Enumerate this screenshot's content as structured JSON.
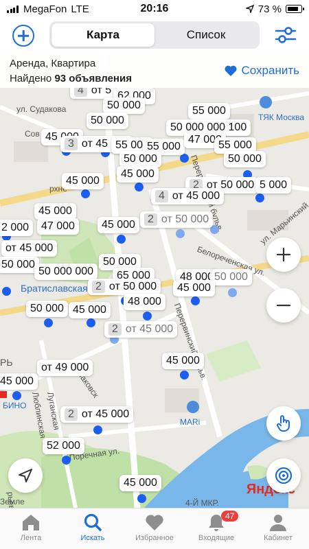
{
  "status_bar": {
    "carrier": "MegaFon",
    "network": "LTE",
    "time": "20:16",
    "battery": "73 %"
  },
  "header": {
    "add_icon": "plus-circle-icon",
    "tabs": [
      {
        "label": "Карта",
        "active": true
      },
      {
        "label": "Список",
        "active": false
      }
    ],
    "filter_icon": "sliders-icon"
  },
  "info_bar": {
    "query": "Аренда, Квартира",
    "found_prefix": "Найдено",
    "found_count": "93 объявления",
    "save_label": "Сохранить",
    "save_icon": "heart-icon"
  },
  "map": {
    "labels": [
      {
        "count": "",
        "price": "62 000"
      },
      {
        "count": "",
        "price": "50 000"
      },
      {
        "count": "",
        "price": "50 000"
      },
      {
        "count": "",
        "price": "55 000"
      },
      {
        "count": "",
        "price": "50 000 000 100"
      },
      {
        "count": "",
        "price": "45 000"
      },
      {
        "count": "3",
        "price": "от 45 000"
      },
      {
        "count": "",
        "price": "55 000"
      },
      {
        "count": "",
        "price": "55 000"
      },
      {
        "count": "",
        "price": "47 000"
      },
      {
        "count": "",
        "price": "55 000"
      },
      {
        "count": "",
        "price": "50 000"
      },
      {
        "count": "",
        "price": "50 000"
      },
      {
        "count": "",
        "price": "45 000"
      },
      {
        "count": "",
        "price": "45 000"
      },
      {
        "count": "2",
        "price": "от 50 000"
      },
      {
        "count": "",
        "price": "5 000"
      },
      {
        "count": "4",
        "price": "от 45 000"
      },
      {
        "count": "",
        "price": "45 000"
      },
      {
        "count": "",
        "price": "47 000"
      },
      {
        "count": "",
        "price": "2 000"
      },
      {
        "count": "",
        "price": "45 000"
      },
      {
        "count": "2",
        "price": "от 50 000"
      },
      {
        "count": "",
        "price": "от 45 000"
      },
      {
        "count": "",
        "price": "50 000"
      },
      {
        "count": "",
        "price": "50 000 000"
      },
      {
        "count": "",
        "price": "50 000"
      },
      {
        "count": "",
        "price": "65 000"
      },
      {
        "count": "",
        "price": "48 000"
      },
      {
        "count": "",
        "price": "50 000"
      },
      {
        "count": "2",
        "price": "от 50 000"
      },
      {
        "count": "",
        "price": "45 000"
      },
      {
        "count": "",
        "price": "48 000"
      },
      {
        "count": "",
        "price": "50 000"
      },
      {
        "count": "",
        "price": "45 000"
      },
      {
        "count": "2",
        "price": "от 45 000"
      },
      {
        "count": "",
        "price": "45 000"
      },
      {
        "count": "",
        "price": "от 49 000"
      },
      {
        "count": "",
        "price": "45 000"
      },
      {
        "count": "2",
        "price": "от 45 000"
      },
      {
        "count": "",
        "price": "52 000"
      },
      {
        "count": "",
        "price": "45 000"
      },
      {
        "count": "",
        "price": "45 000"
      }
    ],
    "streets": [
      "ул. Судакова",
      "Сов",
      "ТЯК Москва",
      "Перервинский бульв.",
      "ул. Марьинский",
      "Белореченская ул.",
      "Перервинский бульв.",
      "Братиславская",
      "рхне",
      "Луганская",
      "Люблинская",
      "Маковск",
      "Поречная ул.",
      "МАRi",
      "4-Й МКР.",
      "РЬ",
      "БИНО",
      "рьевс",
      "Земле"
    ],
    "attribution": "Яндекс",
    "zoom_in_icon": "plus-icon",
    "zoom_out_icon": "minus-icon",
    "gesture_icon": "hand-pointer-icon",
    "locate_icon": "target-icon",
    "navigate_icon": "navigation-arrow-icon"
  },
  "tab_bar": {
    "items": [
      {
        "label": "Лента",
        "icon": "home-icon",
        "active": false
      },
      {
        "label": "Искать",
        "icon": "search-icon",
        "active": true
      },
      {
        "label": "Избранное",
        "icon": "heart-icon",
        "active": false
      },
      {
        "label": "Входящие",
        "icon": "bell-icon",
        "active": false,
        "badge": "47"
      },
      {
        "label": "Кабинет",
        "icon": "person-icon",
        "active": false
      }
    ]
  },
  "colors": {
    "accent": "#1e6dd7",
    "marker": "#1c5ff0",
    "badge": "#e84040"
  }
}
